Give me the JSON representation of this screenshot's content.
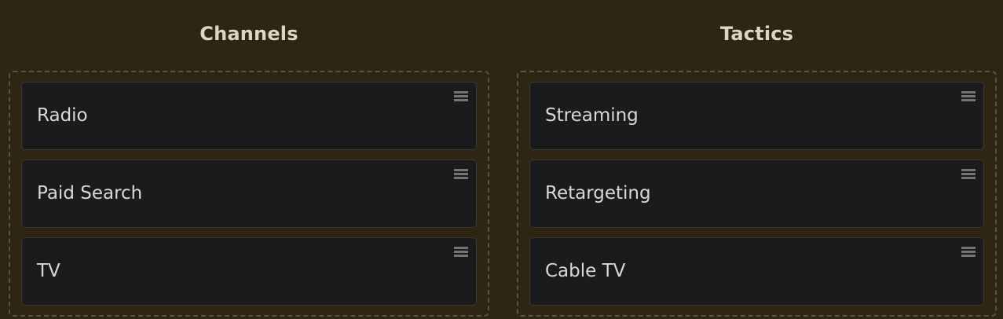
{
  "columns": [
    {
      "title": "Channels",
      "items": [
        {
          "label": "Radio"
        },
        {
          "label": "Paid Search"
        },
        {
          "label": "TV"
        }
      ]
    },
    {
      "title": "Tactics",
      "items": [
        {
          "label": "Streaming"
        },
        {
          "label": "Retargeting"
        },
        {
          "label": "Cable TV"
        }
      ]
    }
  ],
  "icons": {
    "drag_handle": "hamburger-drag-icon"
  },
  "colors": {
    "background": "#2e2612",
    "card": "#1a1b1d",
    "text": "#dcd8cf",
    "dashed_border": "#5b5140"
  }
}
